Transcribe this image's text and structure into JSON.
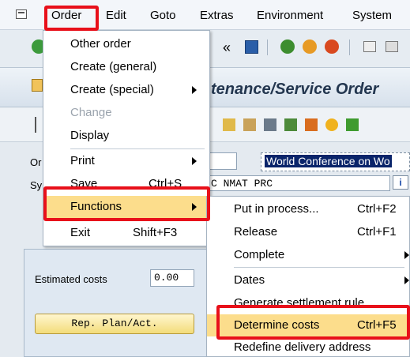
{
  "menubar": {
    "items": [
      "Order",
      "Edit",
      "Goto",
      "Extras",
      "Environment",
      "System"
    ]
  },
  "title": {
    "text": "tenance/Service Order"
  },
  "form": {
    "order_label": "Or",
    "sys_label": "Sy",
    "description_value": "World Conference on Wo",
    "status_value": "C NMAT PRC",
    "info_label": "i",
    "estimated_costs_label": "Estimated costs",
    "estimated_costs_value": "0.00",
    "rep_button_label": "Rep. Plan/Act."
  },
  "order_menu": {
    "items": [
      {
        "label": "Other order",
        "shortcut": "",
        "submenu": false,
        "disabled": false
      },
      {
        "label": "Create (general)",
        "shortcut": "",
        "submenu": false,
        "disabled": false
      },
      {
        "label": "Create (special)",
        "shortcut": "",
        "submenu": true,
        "disabled": false
      },
      {
        "label": "Change",
        "shortcut": "",
        "submenu": false,
        "disabled": true
      },
      {
        "label": "Display",
        "shortcut": "",
        "submenu": false,
        "disabled": false
      },
      {
        "label": "Print",
        "shortcut": "",
        "submenu": true,
        "disabled": false
      },
      {
        "label": "Save",
        "shortcut": "Ctrl+S",
        "submenu": false,
        "disabled": false
      },
      {
        "label": "Functions",
        "shortcut": "",
        "submenu": true,
        "disabled": false
      },
      {
        "label": "Exit",
        "shortcut": "Shift+F3",
        "submenu": false,
        "disabled": false
      }
    ]
  },
  "functions_menu": {
    "items": [
      {
        "label": "Put in process...",
        "shortcut": "Ctrl+F2",
        "submenu": false
      },
      {
        "label": "Release",
        "shortcut": "Ctrl+F1",
        "submenu": false
      },
      {
        "label": "Complete",
        "shortcut": "",
        "submenu": true
      },
      {
        "label": "Dates",
        "shortcut": "",
        "submenu": true
      },
      {
        "label": "Generate settlement rule",
        "shortcut": "",
        "submenu": false
      },
      {
        "label": "Determine costs",
        "shortcut": "Ctrl+F5",
        "submenu": false
      },
      {
        "label": "Redefine delivery address",
        "shortcut": "",
        "submenu": false
      }
    ]
  },
  "colors": {
    "highlight_box": "#e8101a",
    "menu_highlight": "#fcdd8c",
    "title_text": "#23364f"
  }
}
